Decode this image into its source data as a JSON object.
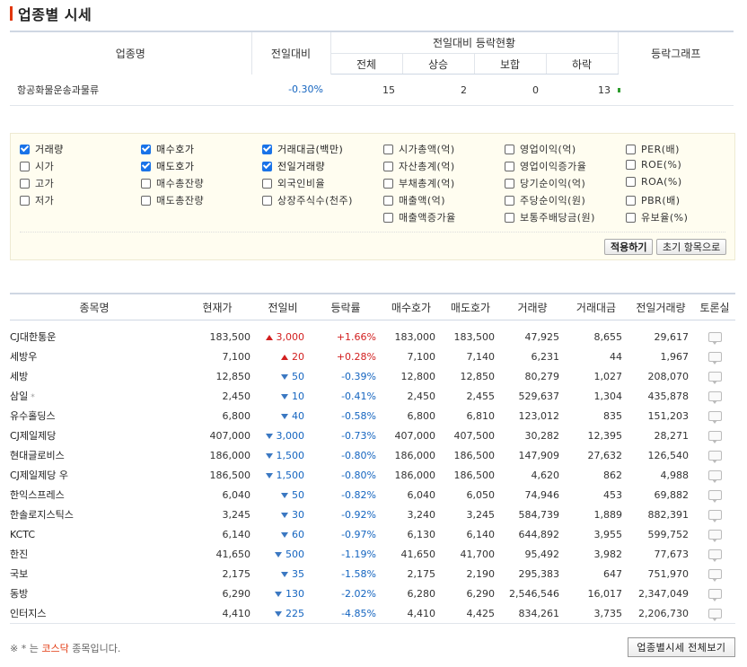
{
  "title": "업종별 시세",
  "summary": {
    "headers": {
      "sector": "업종명",
      "prev": "전일대비",
      "status_group": "전일대비 등락현황",
      "total": "전체",
      "rise": "상승",
      "flat": "보합",
      "fall": "하락",
      "graph": "등락그래프"
    },
    "row": {
      "sector": "항공화물운송과물류",
      "prev": "-0.30%",
      "total": "15",
      "rise": "2",
      "flat": "0",
      "fall": "13"
    }
  },
  "options": {
    "items": [
      {
        "label": "거래량",
        "checked": true
      },
      {
        "label": "시가",
        "checked": false
      },
      {
        "label": "고가",
        "checked": false
      },
      {
        "label": "저가",
        "checked": false
      },
      {
        "label": "매수호가",
        "checked": true
      },
      {
        "label": "매도호가",
        "checked": true
      },
      {
        "label": "매수총잔량",
        "checked": false
      },
      {
        "label": "매도총잔량",
        "checked": false
      },
      {
        "label": "거래대금(백만)",
        "checked": true
      },
      {
        "label": "전일거래량",
        "checked": true
      },
      {
        "label": "외국인비율",
        "checked": false
      },
      {
        "label": "상장주식수(천주)",
        "checked": false
      },
      {
        "label": "시가총액(억)",
        "checked": false
      },
      {
        "label": "자산총계(억)",
        "checked": false
      },
      {
        "label": "부채총계(억)",
        "checked": false
      },
      {
        "label": "매출액(억)",
        "checked": false
      },
      {
        "label": "매출액증가율",
        "checked": false
      },
      {
        "label": "영업이익(억)",
        "checked": false
      },
      {
        "label": "영업이익증가율",
        "checked": false
      },
      {
        "label": "당기순이익(억)",
        "checked": false
      },
      {
        "label": "주당순이익(원)",
        "checked": false
      },
      {
        "label": "보통주배당금(원)",
        "checked": false
      },
      {
        "label": "PER(배)",
        "checked": false
      },
      {
        "label": "ROE(%)",
        "checked": false
      },
      {
        "label": "ROA(%)",
        "checked": false
      },
      {
        "label": "PBR(배)",
        "checked": false
      },
      {
        "label": "유보율(%)",
        "checked": false
      }
    ],
    "apply_label": "적용하기",
    "reset_label": "초기 항목으로"
  },
  "stocks": {
    "headers": [
      "종목명",
      "현재가",
      "전일비",
      "등락률",
      "매수호가",
      "매도호가",
      "거래량",
      "거래대금",
      "전일거래량",
      "토론실"
    ],
    "rows": [
      {
        "name": "CJ대한통운",
        "kosdaq": false,
        "price": "183,500",
        "dir": "up",
        "change": "3,000",
        "rate": "+1.66%",
        "bid": "183,000",
        "ask": "183,500",
        "volume": "47,925",
        "amount": "8,655",
        "prev_volume": "29,617"
      },
      {
        "name": "세방우",
        "kosdaq": false,
        "price": "7,100",
        "dir": "up",
        "change": "20",
        "rate": "+0.28%",
        "bid": "7,100",
        "ask": "7,140",
        "volume": "6,231",
        "amount": "44",
        "prev_volume": "1,967"
      },
      {
        "name": "세방",
        "kosdaq": false,
        "price": "12,850",
        "dir": "down",
        "change": "50",
        "rate": "-0.39%",
        "bid": "12,800",
        "ask": "12,850",
        "volume": "80,279",
        "amount": "1,027",
        "prev_volume": "208,070"
      },
      {
        "name": "삼일",
        "kosdaq": true,
        "price": "2,450",
        "dir": "down",
        "change": "10",
        "rate": "-0.41%",
        "bid": "2,450",
        "ask": "2,455",
        "volume": "529,637",
        "amount": "1,304",
        "prev_volume": "435,878"
      },
      {
        "name": "유수홀딩스",
        "kosdaq": false,
        "price": "6,800",
        "dir": "down",
        "change": "40",
        "rate": "-0.58%",
        "bid": "6,800",
        "ask": "6,810",
        "volume": "123,012",
        "amount": "835",
        "prev_volume": "151,203"
      },
      {
        "name": "CJ제일제당",
        "kosdaq": false,
        "price": "407,000",
        "dir": "down",
        "change": "3,000",
        "rate": "-0.73%",
        "bid": "407,000",
        "ask": "407,500",
        "volume": "30,282",
        "amount": "12,395",
        "prev_volume": "28,271"
      },
      {
        "name": "현대글로비스",
        "kosdaq": false,
        "price": "186,000",
        "dir": "down",
        "change": "1,500",
        "rate": "-0.80%",
        "bid": "186,000",
        "ask": "186,500",
        "volume": "147,909",
        "amount": "27,632",
        "prev_volume": "126,540"
      },
      {
        "name": "CJ제일제당 우",
        "kosdaq": false,
        "price": "186,500",
        "dir": "down",
        "change": "1,500",
        "rate": "-0.80%",
        "bid": "186,000",
        "ask": "186,500",
        "volume": "4,620",
        "amount": "862",
        "prev_volume": "4,988"
      },
      {
        "name": "한익스프레스",
        "kosdaq": false,
        "price": "6,040",
        "dir": "down",
        "change": "50",
        "rate": "-0.82%",
        "bid": "6,040",
        "ask": "6,050",
        "volume": "74,946",
        "amount": "453",
        "prev_volume": "69,882"
      },
      {
        "name": "한솔로지스틱스",
        "kosdaq": false,
        "price": "3,245",
        "dir": "down",
        "change": "30",
        "rate": "-0.92%",
        "bid": "3,240",
        "ask": "3,245",
        "volume": "584,739",
        "amount": "1,889",
        "prev_volume": "882,391"
      },
      {
        "name": "KCTC",
        "kosdaq": false,
        "price": "6,140",
        "dir": "down",
        "change": "60",
        "rate": "-0.97%",
        "bid": "6,130",
        "ask": "6,140",
        "volume": "644,892",
        "amount": "3,955",
        "prev_volume": "599,752"
      },
      {
        "name": "한진",
        "kosdaq": false,
        "price": "41,650",
        "dir": "down",
        "change": "500",
        "rate": "-1.19%",
        "bid": "41,650",
        "ask": "41,700",
        "volume": "95,492",
        "amount": "3,982",
        "prev_volume": "77,673"
      },
      {
        "name": "국보",
        "kosdaq": false,
        "price": "2,175",
        "dir": "down",
        "change": "35",
        "rate": "-1.58%",
        "bid": "2,175",
        "ask": "2,190",
        "volume": "295,383",
        "amount": "647",
        "prev_volume": "751,970"
      },
      {
        "name": "동방",
        "kosdaq": false,
        "price": "6,290",
        "dir": "down",
        "change": "130",
        "rate": "-2.02%",
        "bid": "6,280",
        "ask": "6,290",
        "volume": "2,546,546",
        "amount": "16,017",
        "prev_volume": "2,347,049"
      },
      {
        "name": "인터지스",
        "kosdaq": false,
        "price": "4,410",
        "dir": "down",
        "change": "225",
        "rate": "-4.85%",
        "bid": "4,410",
        "ask": "4,425",
        "volume": "834,261",
        "amount": "3,735",
        "prev_volume": "2,206,730"
      }
    ]
  },
  "footer": {
    "note_prefix": "※ * 는",
    "note_kosdaq": "코스닥",
    "note_suffix": "종목입니다.",
    "view_all_label": "업종별시세 전체보기"
  },
  "colors": {
    "up": "#d21f1f",
    "down": "#1565c0",
    "accent": "#e2370e",
    "checkbox": "#1a73e8"
  }
}
